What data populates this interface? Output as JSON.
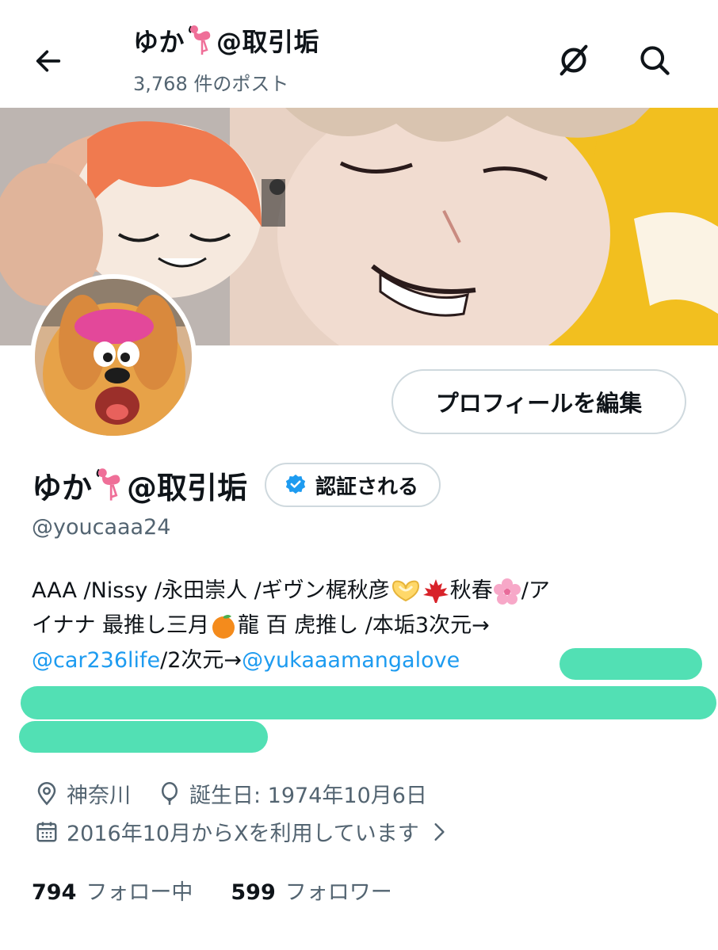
{
  "header": {
    "name_prefix": "ゆか",
    "name_suffix": "@取引垢",
    "post_count": "3,768 件のポスト"
  },
  "profile": {
    "name_prefix": "ゆか",
    "name_suffix": "@取引垢",
    "handle": "@youcaaa24",
    "edit_button": "プロフィールを編集",
    "verify_button": "認証される"
  },
  "bio": {
    "line1_text": "AAA /Nissy /永田崇人 /ギヴン梶秋彦 ",
    "line1_mid": "秋春",
    "line1_end": "/ア",
    "line2_start": "イナナ 最推し三月",
    "line2_end": "龍 百 虎推し /本垢3次元→",
    "line3_link1": "@car236life",
    "line3_mid": " /2次元→",
    "line3_link2": "@yukaaamangalove"
  },
  "meta": {
    "location": "神奈川",
    "birthday": "誕生日: 1974年10月6日",
    "joined": "2016年10月からXを利用しています"
  },
  "stats": {
    "following_count": "794",
    "following_label": "フォロー中",
    "followers_count": "599",
    "followers_label": "フォロワー"
  },
  "colors": {
    "link": "#1d9bf0",
    "secondary_text": "#536471",
    "redaction": "#52e0b4",
    "verified_badge": "#1d9bf0"
  },
  "icons": [
    "back-arrow-icon",
    "grok-icon",
    "search-icon",
    "flamingo-emoji",
    "verified-badge-icon",
    "heart-hands-emoji",
    "maple-leaf-emoji",
    "cherry-blossom-emoji",
    "orange-emoji",
    "location-icon",
    "balloon-icon",
    "calendar-icon",
    "chevron-right-icon"
  ]
}
